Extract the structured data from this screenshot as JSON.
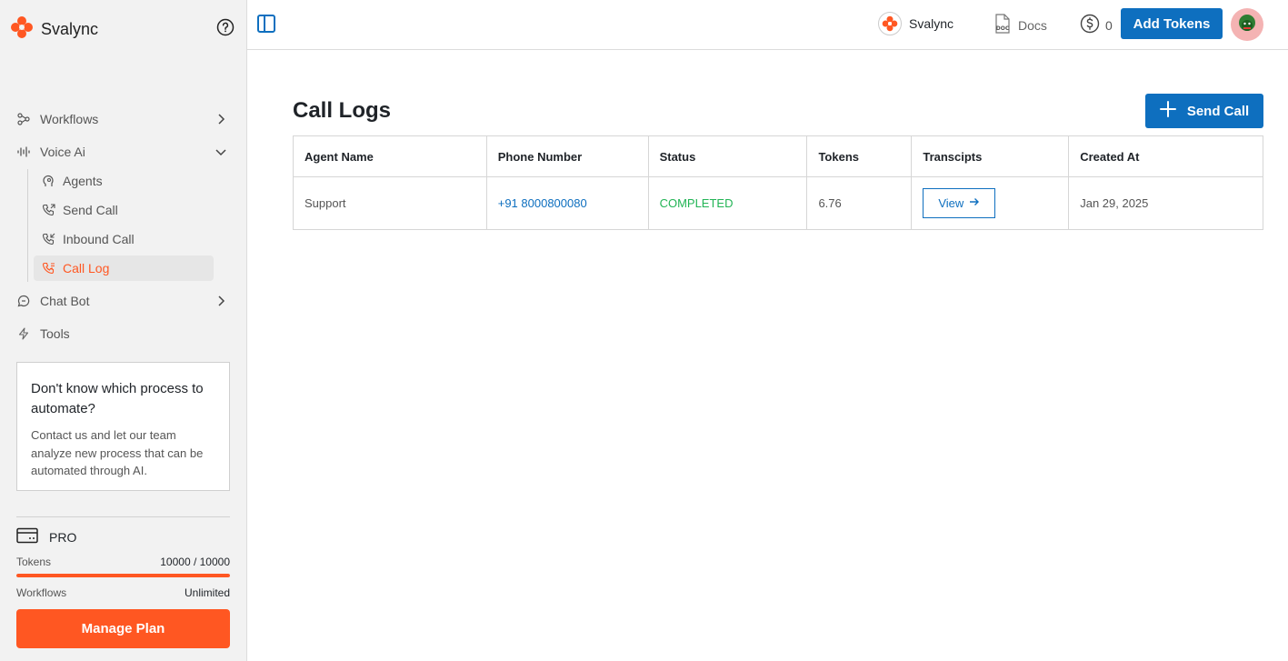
{
  "brand": {
    "name": "Svalync"
  },
  "nav": {
    "workflows": "Workflows",
    "voice_ai": "Voice Ai",
    "agents": "Agents",
    "send_call": "Send Call",
    "inbound_call": "Inbound Call",
    "call_log": "Call Log",
    "chat_bot": "Chat Bot",
    "tools": "Tools"
  },
  "promo": {
    "title": "Don't know which process to automate?",
    "body": "Contact us and let our team analyze new process that can be automated through AI."
  },
  "plan": {
    "name": "PRO",
    "tokens_label": "Tokens",
    "tokens_value": "10000 / 10000",
    "tokens_fraction": 1.0,
    "workflows_label": "Workflows",
    "workflows_value": "Unlimited",
    "manage_label": "Manage Plan"
  },
  "topbar": {
    "workspace": "Svalync",
    "docs": "Docs",
    "balance": "0",
    "add_tokens": "Add Tokens"
  },
  "main": {
    "title": "Call Logs",
    "send_call": "Send Call",
    "columns": [
      "Agent Name",
      "Phone Number",
      "Status",
      "Tokens",
      "Transcipts",
      "Created At"
    ],
    "rows": [
      {
        "agent": "Support",
        "phone": "+91 8000800080",
        "status": "COMPLETED",
        "tokens": "6.76",
        "transcript_action": "View",
        "created": "Jan 29, 2025"
      }
    ]
  },
  "colors": {
    "accent": "#ff5722",
    "primary": "#0e6fbf",
    "success": "#22b455"
  }
}
